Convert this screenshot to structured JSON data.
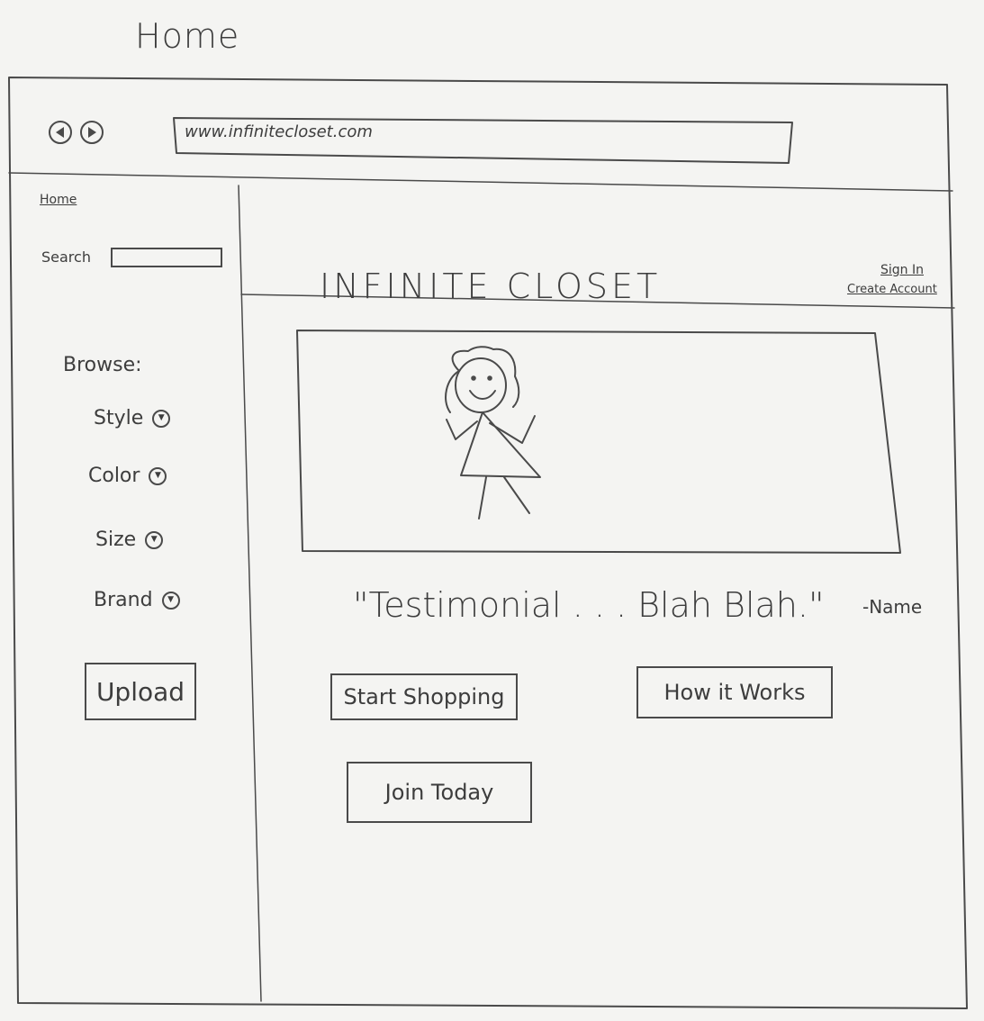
{
  "page_title": "Home",
  "browser": {
    "url": "www.infinitecloset.com",
    "back_icon": "back-arrow-icon",
    "forward_icon": "forward-arrow-icon"
  },
  "sidebar": {
    "home_link": "Home",
    "search_label": "Search",
    "browse_label": "Browse:",
    "filters": [
      {
        "label": "Style",
        "icon": "dropdown-arrow-icon"
      },
      {
        "label": "Color",
        "icon": "dropdown-arrow-icon"
      },
      {
        "label": "Size",
        "icon": "dropdown-arrow-icon"
      },
      {
        "label": "Brand",
        "icon": "dropdown-arrow-icon"
      }
    ],
    "upload_button": "Upload"
  },
  "header": {
    "logo": "INFINITE CLOSET",
    "sign_in": "Sign In",
    "create_account": "Create Account"
  },
  "main": {
    "testimonial": "\"Testimonial . . . Blah Blah.\"",
    "testimonial_name": "-Name",
    "buttons": {
      "start_shopping": "Start Shopping",
      "how_it_works": "How it Works",
      "join_today": "Join Today"
    }
  }
}
